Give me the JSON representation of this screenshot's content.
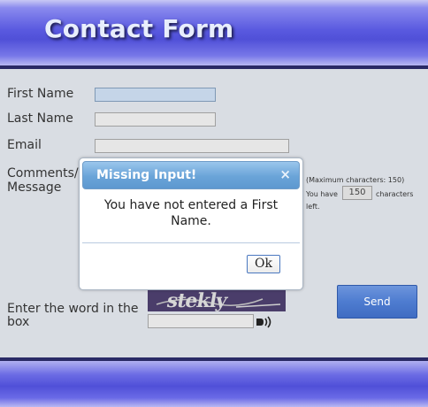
{
  "header": {
    "title": "Contact Form"
  },
  "form": {
    "first_name_label": "First Name",
    "last_name_label": "Last Name",
    "email_label": "Email",
    "comments_label_line1": "Comments/",
    "comments_label_line2": "Message",
    "max_chars_note": "(Maximum characters: 150)",
    "you_have": "You have",
    "chars_remaining": "150",
    "characters": "characters",
    "left": "left.",
    "captcha_label_line1": "Enter the word in the",
    "captcha_label_line2": "box",
    "captcha_word": "stekly",
    "send_label": "Send"
  },
  "dialog": {
    "title": "Missing Input!",
    "close_glyph": "×",
    "message": "You have not entered a First Name.",
    "ok_label": "Ok"
  },
  "icons": {
    "audio": "audio-speaker-icon",
    "close": "close-icon"
  },
  "colors": {
    "header": "#5a5ae0",
    "dialog_title": "#6aa4d8",
    "send_button": "#4e7cd0"
  }
}
